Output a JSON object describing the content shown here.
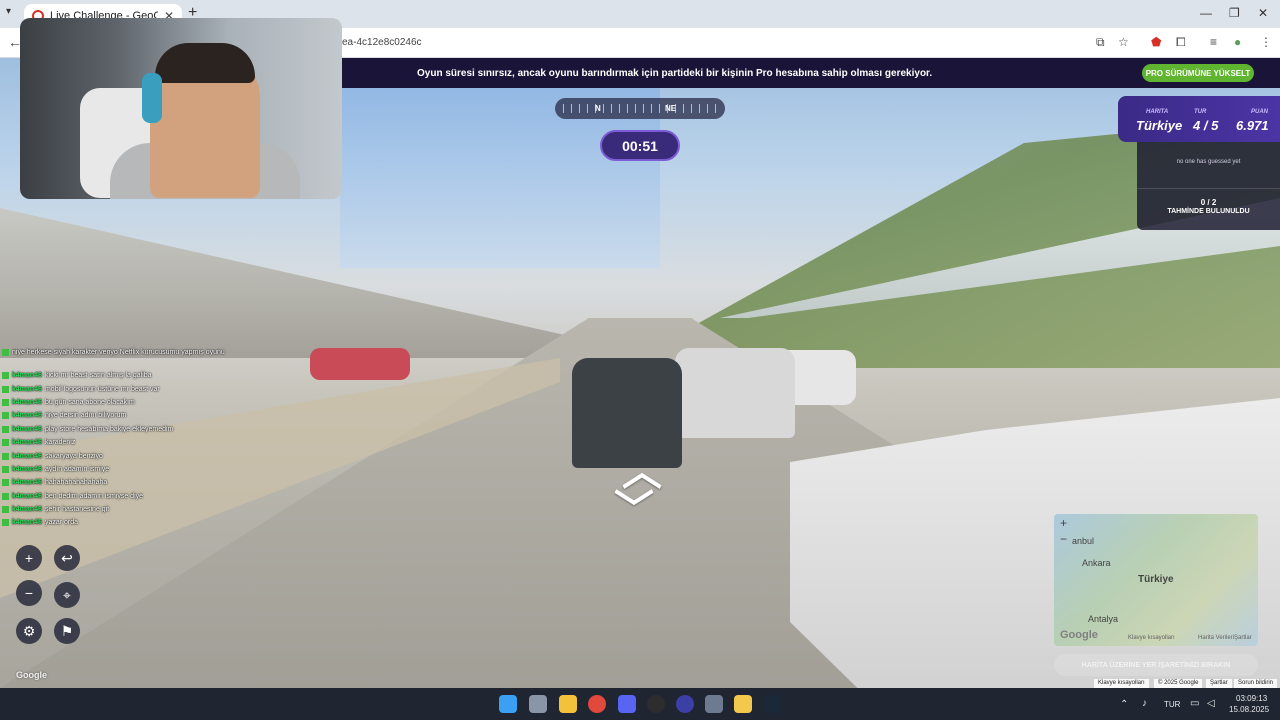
{
  "browser": {
    "tab_title": "Live Challenge - GeoGuessr",
    "close_glyph": "✕",
    "new_tab_glyph": "+",
    "url_text": "ea-4c12e8c0246c"
  },
  "banner": {
    "message": "Oyun süresi sınırsız, ancak oyunu barındırmak için partideki bir kişinin Pro hesabına sahip olması gerekiyor.",
    "upgrade_label": "PRO SÜRÜMÜNE YÜKSELT"
  },
  "compass": {
    "n": "N",
    "ne": "NE"
  },
  "timer": "00:51",
  "info": {
    "map_label": "HARITA",
    "map_value": "Türkiye",
    "round_label": "TUR",
    "round_value": "4 / 5",
    "score_label": "PUAN",
    "score_value": "6.971"
  },
  "guesses": {
    "none_text": "no one has guessed yet",
    "count": "0 / 2",
    "found_label": "TAHMİNDE BULUNULDU"
  },
  "chat": [
    {
      "user": "",
      "text": "niye herkese siyah karakter veriyo Netflix kurucusumu yapmış oyunu"
    },
    {
      "user": "k4man46",
      "text": "kicki mr beast satın almış la galiba"
    },
    {
      "user": "k4man46",
      "text": "mobil logosunun üstüne mr beast var"
    },
    {
      "user": "k4man46",
      "text": "bu gün sana abone olacakım"
    },
    {
      "user": "k4man46",
      "text": "niye dersin adını biliyorum"
    },
    {
      "user": "k4man46",
      "text": "play store hesabıma bakiye ekleyemedim"
    },
    {
      "user": "k4man46",
      "text": "karadeniz"
    },
    {
      "user": "k4man46",
      "text": "sakaryaya benziyo"
    },
    {
      "user": "k4man46",
      "text": "aydın adamın ismiye"
    },
    {
      "user": "k4man46",
      "text": "hahahahahahahaha"
    },
    {
      "user": "k4man46",
      "text": "ben dedim adamın ismiyse diye"
    },
    {
      "user": "k4man46",
      "text": "şehir hastanesine git"
    },
    {
      "user": "k4man46",
      "text": "yazar orda"
    }
  ],
  "map": {
    "city1": "anbul",
    "city2": "Ankara",
    "country": "Türkiye",
    "city3": "Antalya",
    "zoom_in": "+",
    "zoom_out": "−",
    "google": "Google",
    "footer": [
      "Klavye kısayolları",
      "Harita Verileri",
      "Şartlar"
    ],
    "guess_button": "HARİTA ÜZERİNE YER İŞARETİNİZİ BIRAKIN"
  },
  "attribution": [
    "Klavye kısayolları",
    "© 2025 Google",
    "Şartlar",
    "Sorun bildirin"
  ],
  "google_watermark": "Google",
  "tray": {
    "lang": "TUR",
    "time": "03:09:13",
    "date": "15.08.2025"
  }
}
